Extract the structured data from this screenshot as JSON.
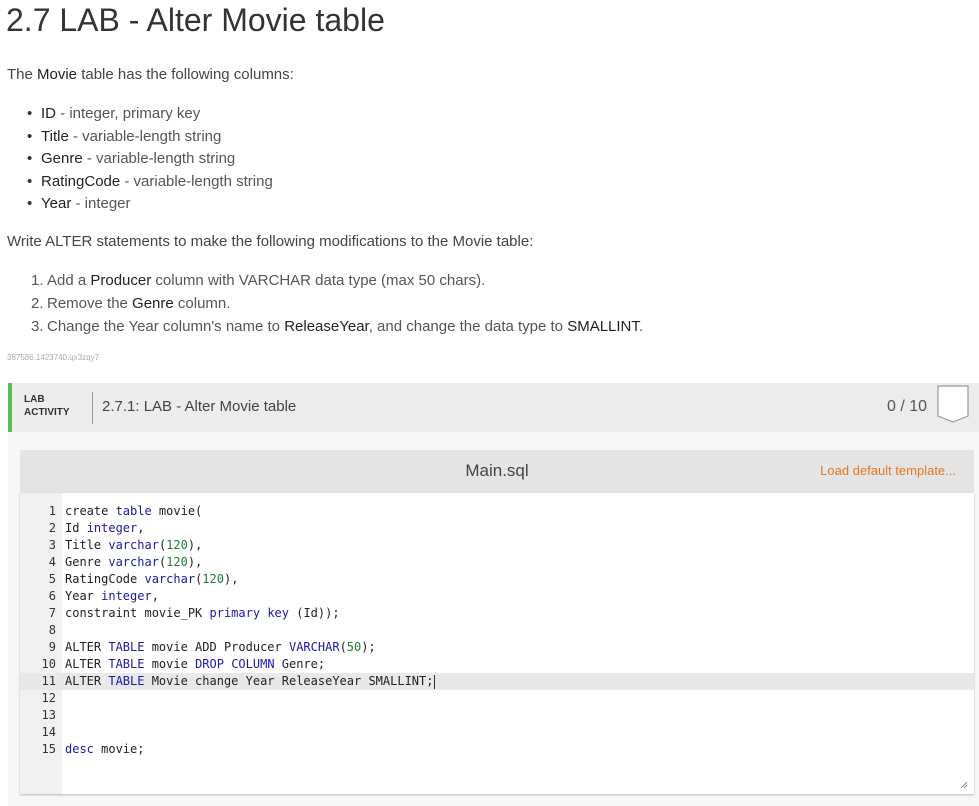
{
  "page": {
    "title": "2.7 LAB - Alter Movie table"
  },
  "intro": {
    "prefix": "The ",
    "table": "Movie",
    "suffix": " table has the following columns:"
  },
  "columns": [
    {
      "name": "ID",
      "desc": " - integer, primary key"
    },
    {
      "name": "Title",
      "desc": " - variable-length string"
    },
    {
      "name": "Genre",
      "desc": " - variable-length string"
    },
    {
      "name": "RatingCode",
      "desc": " - variable-length string"
    },
    {
      "name": "Year",
      "desc": " - integer"
    }
  ],
  "instructions": "Write ALTER statements to make the following modifications to the Movie table:",
  "tasks": [
    {
      "num": "1.",
      "parts": [
        "Add a ",
        "Producer",
        " column with VARCHAR data type (max 50 chars)."
      ]
    },
    {
      "num": "2.",
      "parts": [
        "Remove the ",
        "Genre",
        " column."
      ]
    },
    {
      "num": "3.",
      "parts": [
        "Change the Year column's name to ",
        "ReleaseYear",
        ", and change the data type to ",
        "SMALLINT",
        "."
      ]
    }
  ],
  "ref_id": "387586.1423740.qx3zqy7",
  "lab": {
    "label_line1": "LAB",
    "label_line2": "ACTIVITY",
    "title": "2.7.1: LAB - Alter Movie table",
    "score": "0 / 10"
  },
  "editor": {
    "file_name": "Main.sql",
    "load_template": "Load default template...",
    "active_line": 11,
    "lines": [
      "create table movie(",
      "Id integer,",
      "Title varchar(120),",
      "Genre varchar(120),",
      "RatingCode varchar(120),",
      "Year integer,",
      "constraint movie_PK primary key (Id));",
      "",
      "ALTER TABLE movie ADD Producer VARCHAR(50);",
      "ALTER TABLE movie DROP COLUMN Genre;",
      "ALTER TABLE Movie change Year ReleaseYear SMALLINT;",
      "",
      "",
      "",
      "desc movie;"
    ]
  },
  "colors": {
    "accent_green": "#5cb85c",
    "link_orange": "#e87722",
    "keyword_blue": "#1a1aa6",
    "number_green": "#1e7e34"
  },
  "icons": {
    "badge": "bookmark-badge-icon",
    "resize": "resize-grip-icon"
  }
}
